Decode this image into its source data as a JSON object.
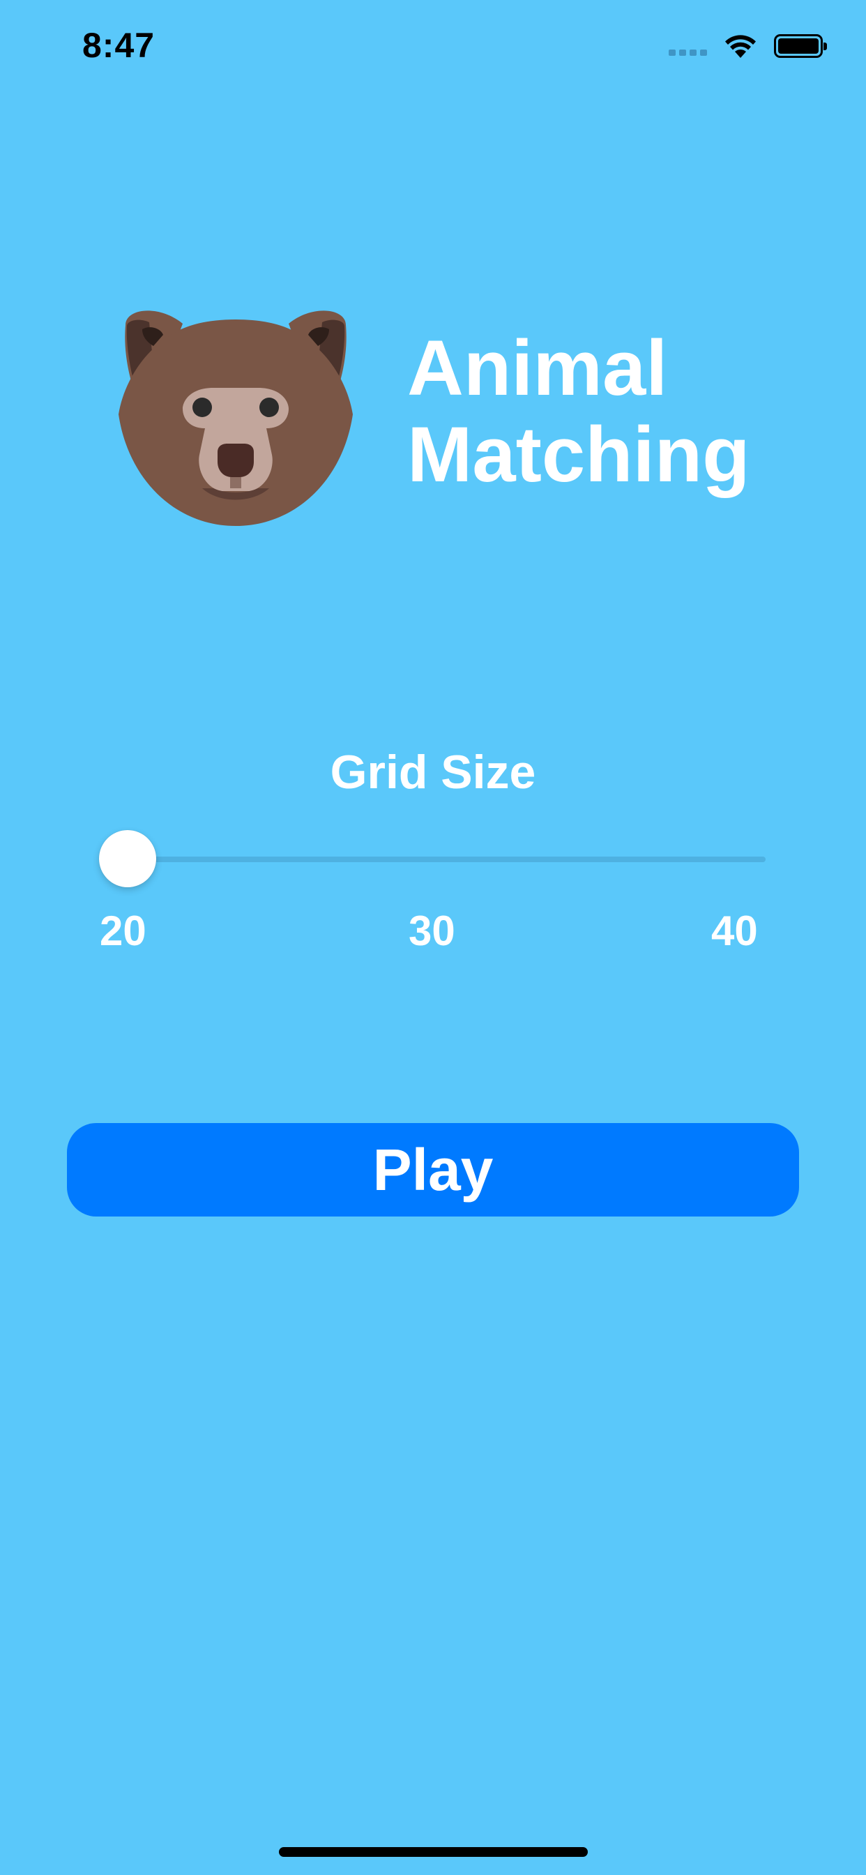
{
  "status_bar": {
    "time": "8:47",
    "icons": [
      "cellular-signal-icon",
      "wifi-icon",
      "battery-icon"
    ],
    "battery_level": 1.0
  },
  "header": {
    "logo_icon": "bear-face-icon",
    "title_line1": "Animal",
    "title_line2": "Matching"
  },
  "grid_size": {
    "label": "Grid Size",
    "min": 20,
    "max": 40,
    "value": 20,
    "ticks": [
      "20",
      "30",
      "40"
    ]
  },
  "play_button": {
    "label": "Play"
  },
  "colors": {
    "background": "#5AC8FA",
    "accent": "#007AFF",
    "text": "#FFFFFF",
    "bear_fur": "#7A5646",
    "bear_ear_inner": "#4B332C",
    "bear_muzzle": "#C2A69C"
  }
}
